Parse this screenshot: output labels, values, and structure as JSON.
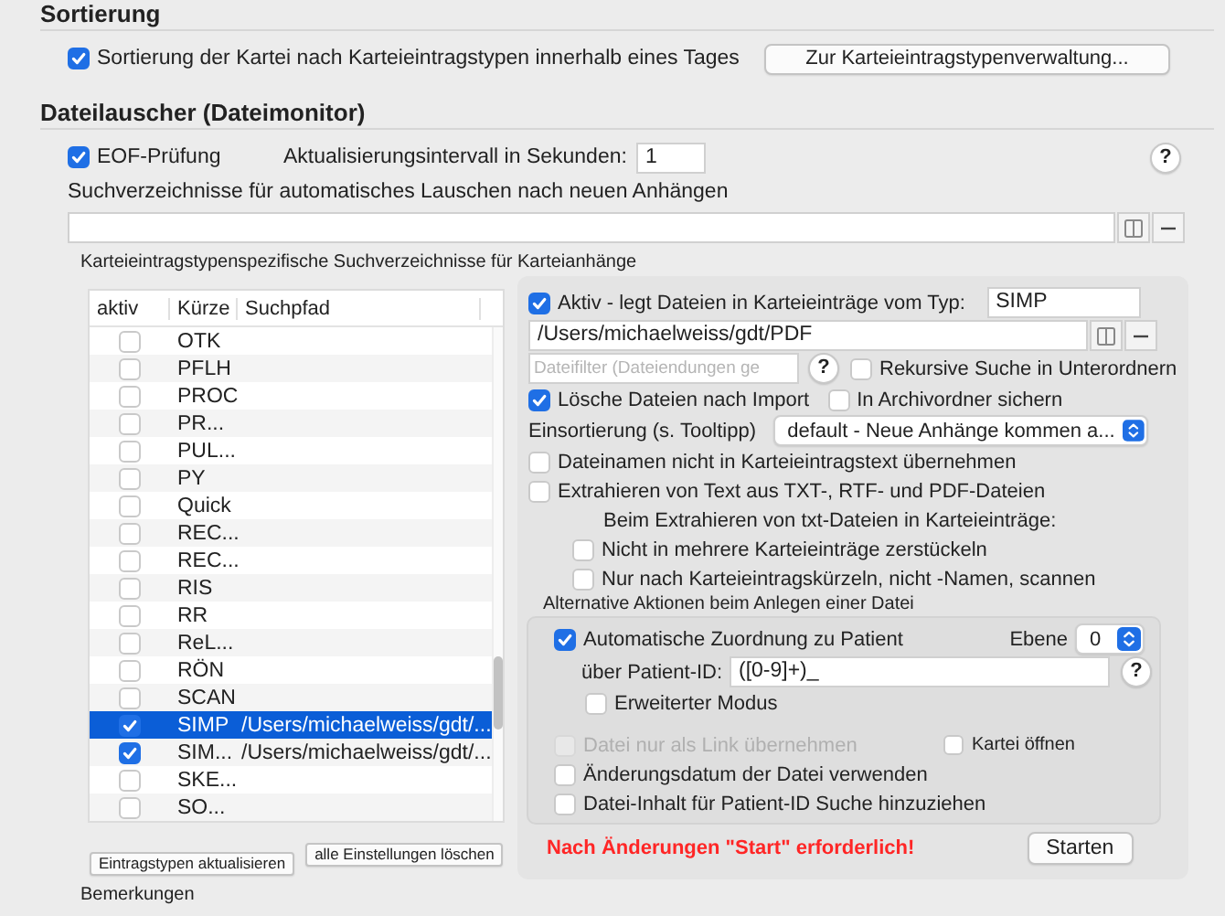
{
  "sortierung": {
    "title": "Sortierung",
    "option": {
      "label": "Sortierung der Kartei nach Karteieintragstypen innerhalb eines Tages",
      "checked": true
    },
    "button": "Zur Karteieintragstypenverwaltung..."
  },
  "dateilauscher": {
    "title": "Dateilauscher (Dateimonitor)",
    "eof": {
      "label": "EOF-Prüfung",
      "checked": true
    },
    "interval": {
      "label": "Aktualisierungsintervall in Sekunden:",
      "value": "1"
    },
    "help": "?",
    "search_dirs_label": "Suchverzeichnisse für automatisches Lauschen nach neuen Anhängen"
  },
  "type_dirs": {
    "title": "Karteieintragstypenspezifische Suchverzeichnisse für Karteianhänge",
    "table": {
      "columns": [
        "aktiv",
        "Kürze",
        "Suchpfad"
      ],
      "rows": [
        {
          "active": false,
          "code": "OTK",
          "selected": false
        },
        {
          "active": false,
          "code": "PFLH",
          "selected": false
        },
        {
          "active": false,
          "code": "PROC",
          "selected": false
        },
        {
          "active": false,
          "code": "PR...",
          "selected": false
        },
        {
          "active": false,
          "code": "PUL...",
          "selected": false
        },
        {
          "active": false,
          "code": "PY",
          "selected": false
        },
        {
          "active": false,
          "code": "Quick",
          "selected": false
        },
        {
          "active": false,
          "code": "REC...",
          "selected": false
        },
        {
          "active": false,
          "code": "REC...",
          "selected": false
        },
        {
          "active": false,
          "code": "RIS",
          "selected": false
        },
        {
          "active": false,
          "code": "RR",
          "selected": false
        },
        {
          "active": false,
          "code": "ReL...",
          "selected": false
        },
        {
          "active": false,
          "code": "RÖN",
          "selected": false
        },
        {
          "active": false,
          "code": "SCAN",
          "selected": false
        },
        {
          "active": true,
          "code": "SIMP",
          "path": "/Users/michaelweiss/gdt/...",
          "selected": true
        },
        {
          "active": true,
          "code": "SIM...",
          "path": "/Users/michaelweiss/gdt/...",
          "selected": false
        },
        {
          "active": false,
          "code": "SKE...",
          "selected": false
        },
        {
          "active": false,
          "code": "SO...",
          "selected": false
        }
      ]
    },
    "buttons": [
      "Eintragstypen aktualisieren",
      "alle Einstellungen löschen"
    ]
  },
  "detail": {
    "active": {
      "label": "Aktiv - legt Dateien in Karteieinträge vom Typ:",
      "checked": true
    },
    "type": "SIMP",
    "path": "/Users/michaelweiss/gdt/PDF",
    "filter": {
      "placeholder": "Dateifilter (Dateiendungen ge"
    },
    "filter_help": "?",
    "recursive": {
      "label": "Rekursive Suche in Unterordnern",
      "checked": false
    },
    "delete": {
      "label": "Lösche Dateien nach Import",
      "checked": true
    },
    "archive": {
      "label": "In Archivordner sichern",
      "checked": false
    },
    "sort": {
      "label": "Einsortierung (s. Tooltipp)",
      "value": "default - Neue Anhänge kommen a..."
    },
    "no_filename": {
      "label": "Dateinamen nicht in Karteieintragstext übernehmen",
      "checked": false
    },
    "extract": {
      "label": "Extrahieren von Text aus TXT-, RTF- und PDF-Dateien",
      "checked": false
    },
    "extract_caption": "Beim Extrahieren von txt-Dateien in Karteieinträge:",
    "extract_options": [
      {
        "label": "Nicht in mehrere Karteieinträge zerstückeln",
        "checked": false
      },
      {
        "label": "Nur nach Karteieintragskürzeln, nicht -Namen, scannen",
        "checked": false
      }
    ],
    "alternative": {
      "title": "Alternative Aktionen beim Anlegen einer Datei",
      "auto_assign": {
        "label": "Automatische Zuordnung zu Patient",
        "checked": true
      },
      "level": {
        "label": "Ebene",
        "value": "0"
      },
      "patient_id": {
        "label": "über Patient-ID:",
        "value": "([0-9]+)_"
      },
      "help": "?",
      "extended": {
        "label": "Erweiterter Modus",
        "checked": false
      },
      "link_only": {
        "label": "Datei nur als Link übernehmen",
        "checked": false,
        "disabled": true
      },
      "open_file": {
        "label": "Kartei öffnen",
        "checked": false
      },
      "options": [
        {
          "label": "Änderungsdatum der Datei verwenden",
          "checked": false
        },
        {
          "label": "Datei-Inhalt für Patient-ID Suche hinzuziehen",
          "checked": false
        }
      ]
    },
    "warning": "Nach Änderungen \"Start\" erforderlich!",
    "start_button": "Starten"
  },
  "remarks_title": "Bemerkungen"
}
